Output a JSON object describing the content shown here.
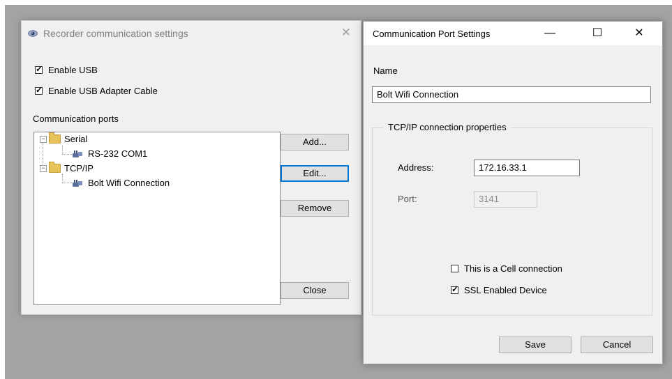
{
  "recorder_window": {
    "title": "Recorder communication settings",
    "enable_usb": {
      "label": "Enable USB",
      "checked": true
    },
    "enable_usb_adapter": {
      "label": "Enable USB Adapter Cable",
      "checked": true
    },
    "ports_label": "Communication ports",
    "tree": {
      "serial_label": "Serial",
      "serial_child": "RS-232 COM1",
      "tcpip_label": "TCP/IP",
      "tcpip_child": "Bolt Wifi Connection"
    },
    "buttons": {
      "add": "Add...",
      "edit": "Edit...",
      "remove": "Remove",
      "close": "Close"
    }
  },
  "port_window": {
    "title": "Communication Port Settings",
    "controls": {
      "minimize": "—",
      "maximize": "☐",
      "close": "✕"
    },
    "name_label": "Name",
    "name_value": "Bolt Wifi Connection",
    "group_title": "TCP/IP connection properties",
    "address_label": "Address:",
    "address_value": "172.16.33.1",
    "port_label": "Port:",
    "port_value": "3141",
    "cell_connection": {
      "label": "This is a Cell connection",
      "checked": false
    },
    "ssl_enabled": {
      "label": "SSL Enabled Device",
      "checked": true
    },
    "save": "Save",
    "cancel": "Cancel"
  },
  "colors": {
    "desktop": "#a3a3a3",
    "window_bg": "#f0f0f0",
    "focus_border": "#0078d7",
    "folder": "#e8c25a"
  }
}
